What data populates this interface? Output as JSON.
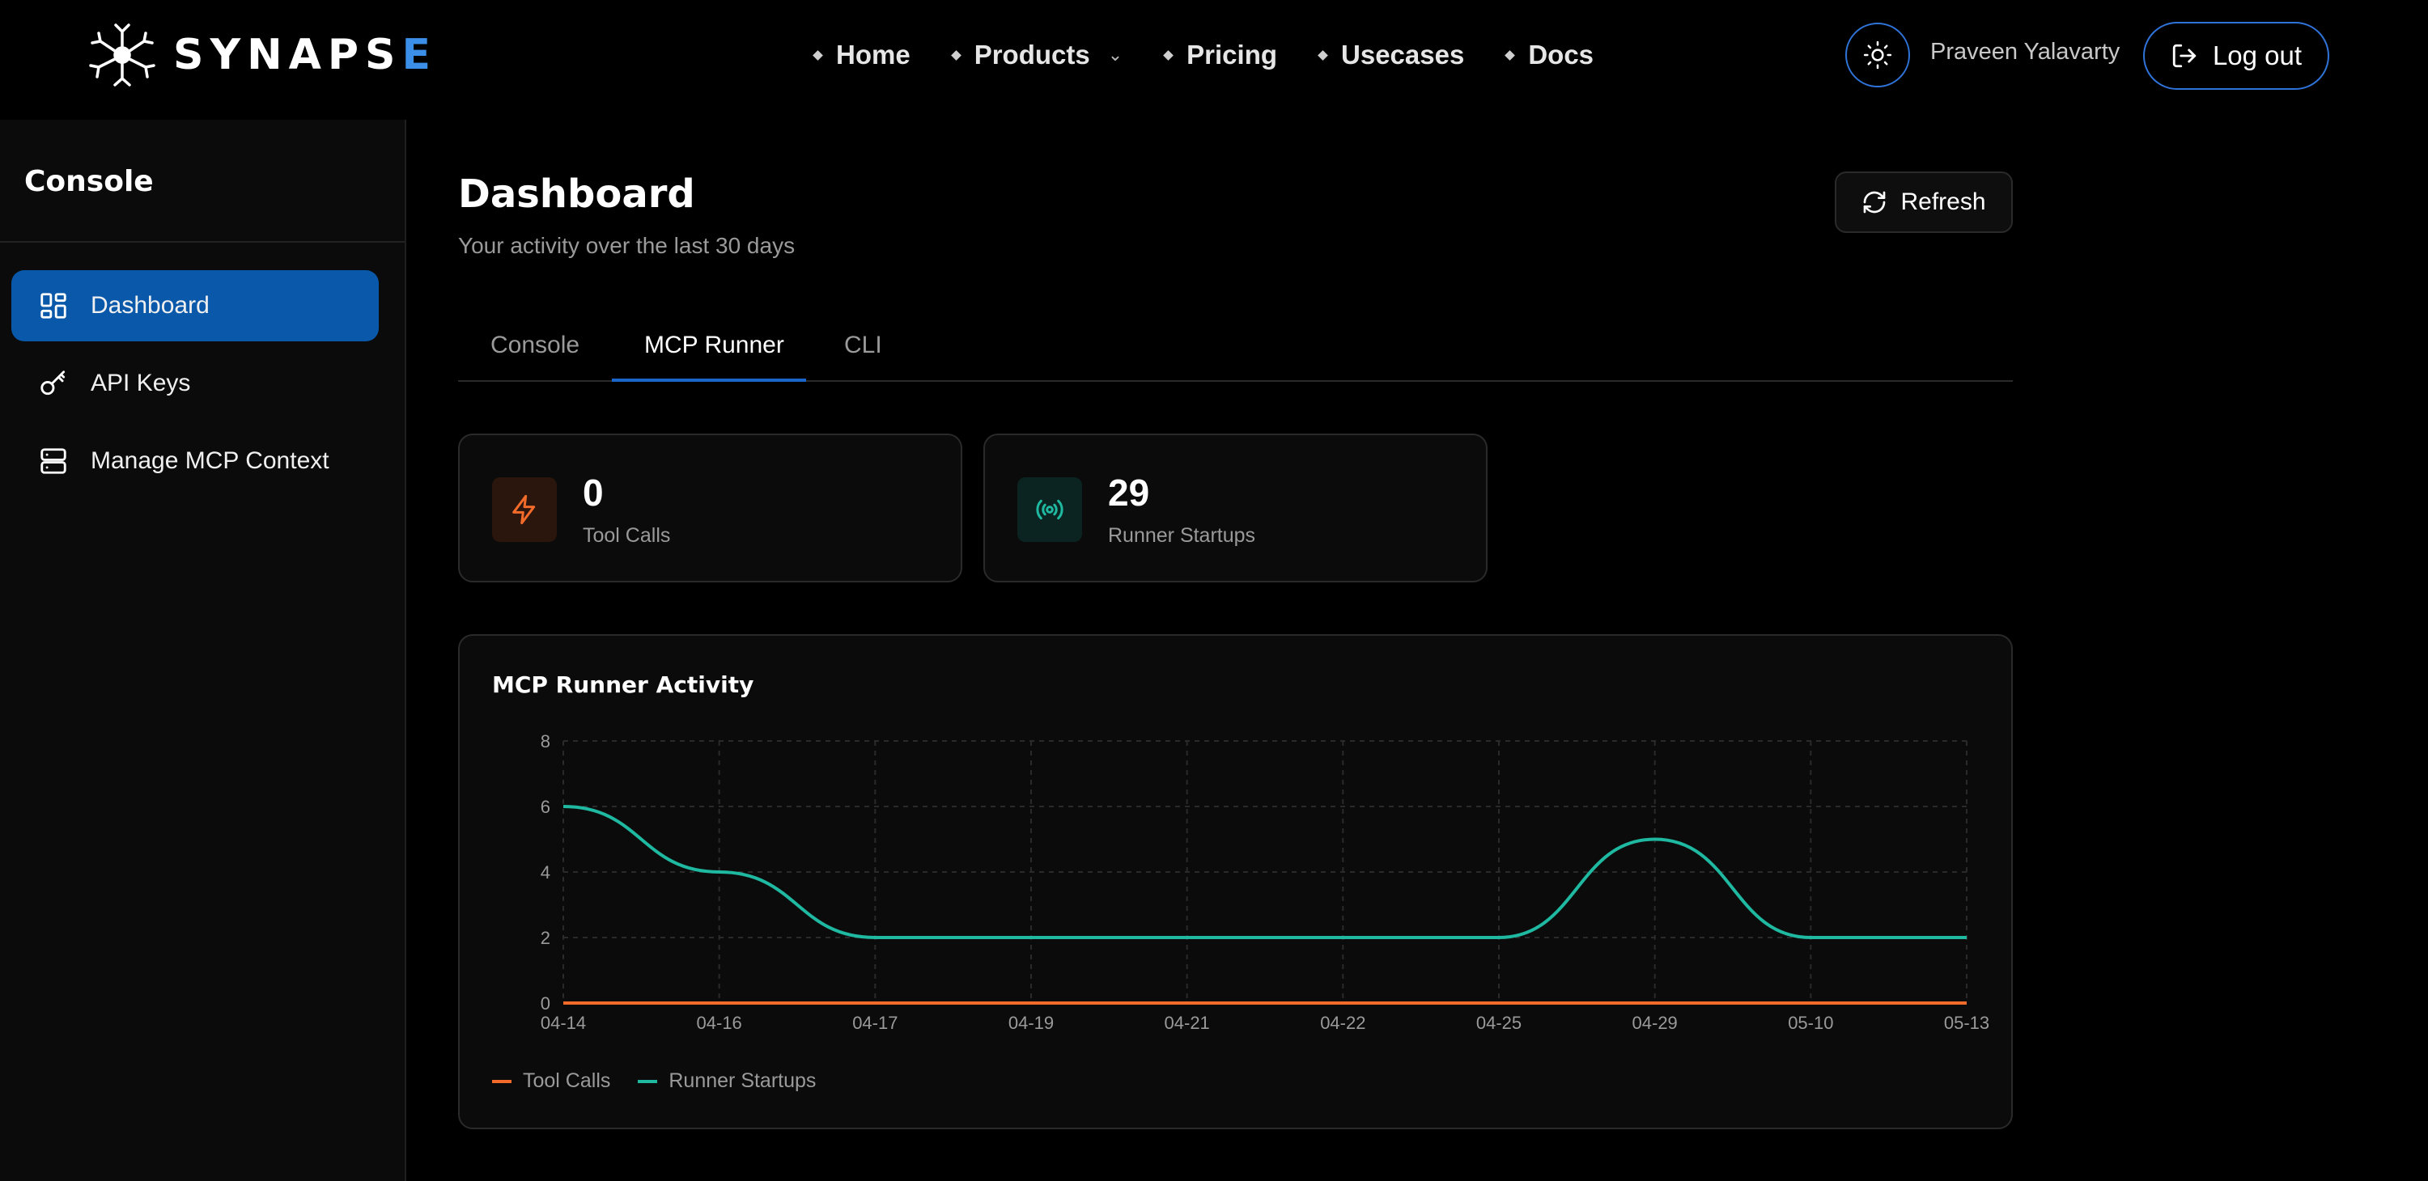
{
  "brand": {
    "name_main": "SYNAPS",
    "name_accent": "E",
    "accent_color": "#3b8fe8"
  },
  "nav": {
    "items": [
      {
        "label": "Home"
      },
      {
        "label": "Products",
        "has_dropdown": true
      },
      {
        "label": "Pricing"
      },
      {
        "label": "Usecases"
      },
      {
        "label": "Docs"
      }
    ]
  },
  "user": {
    "name": "Praveen Yalavarty",
    "logout_label": "Log out"
  },
  "sidebar": {
    "title": "Console",
    "items": [
      {
        "label": "Dashboard",
        "icon": "dashboard-icon",
        "active": true
      },
      {
        "label": "API Keys",
        "icon": "key-icon",
        "active": false
      },
      {
        "label": "Manage MCP Context",
        "icon": "server-icon",
        "active": false
      }
    ]
  },
  "main": {
    "title": "Dashboard",
    "subtitle": "Your activity over the last 30 days",
    "refresh_label": "Refresh",
    "tabs": [
      {
        "label": "Console",
        "active": false
      },
      {
        "label": "MCP Runner",
        "active": true
      },
      {
        "label": "CLI",
        "active": false
      }
    ],
    "stats": [
      {
        "value": "0",
        "label": "Tool Calls",
        "icon": "bolt-icon",
        "color": "#f26b2a"
      },
      {
        "value": "29",
        "label": "Runner Startups",
        "icon": "broadcast-icon",
        "color": "#1fb8a0"
      }
    ]
  },
  "chart_data": {
    "type": "line",
    "title": "MCP Runner Activity",
    "categories": [
      "04-14",
      "04-16",
      "04-17",
      "04-19",
      "04-21",
      "04-22",
      "04-25",
      "04-29",
      "05-10",
      "05-13"
    ],
    "series": [
      {
        "name": "Tool Calls",
        "color": "#f26b2a",
        "values": [
          0,
          0,
          0,
          0,
          0,
          0,
          0,
          0,
          0,
          0
        ]
      },
      {
        "name": "Runner Startups",
        "color": "#1fb8a0",
        "values": [
          6,
          4,
          2,
          2,
          2,
          2,
          2,
          5,
          2,
          2
        ]
      }
    ],
    "ylim": [
      0,
      8
    ],
    "yticks": [
      0,
      2,
      4,
      6,
      8
    ],
    "grid": true,
    "legend": "bottom-left"
  }
}
